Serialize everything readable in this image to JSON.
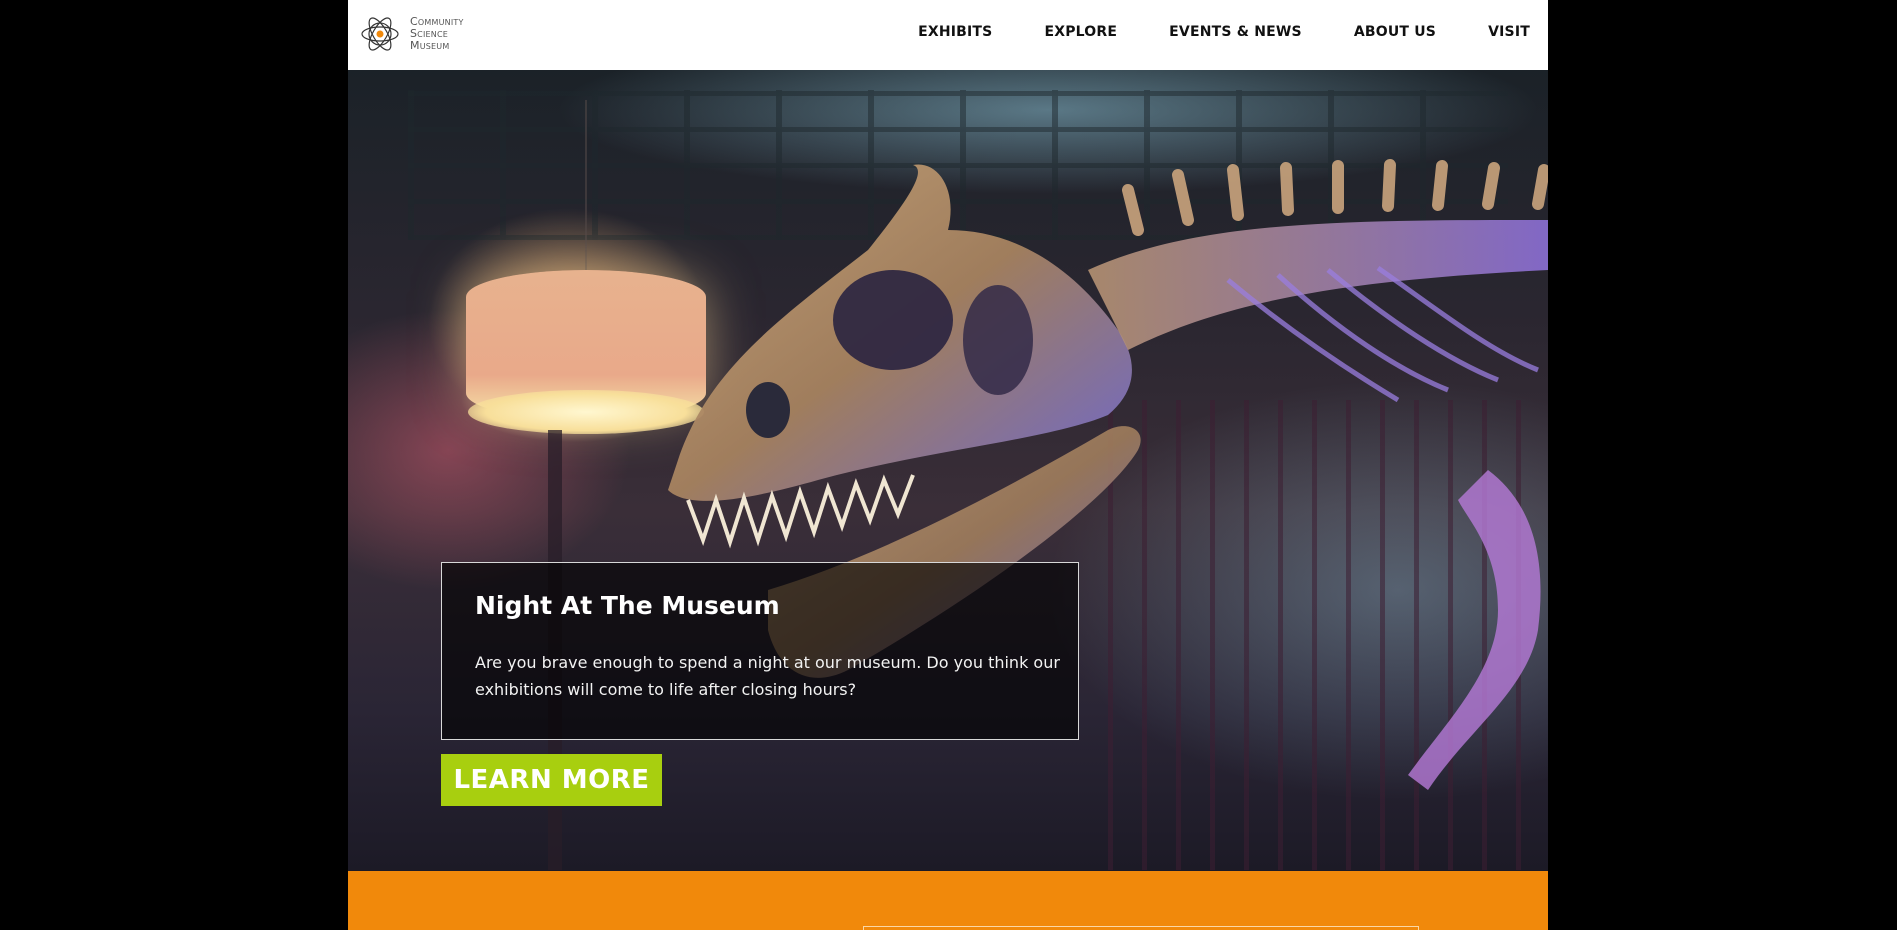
{
  "brand": {
    "logo_icon": "atom-icon",
    "name_lines": [
      "Community",
      "Science",
      "Museum"
    ]
  },
  "nav": {
    "items": [
      "EXHIBITS",
      "EXPLORE",
      "EVENTS & NEWS",
      "ABOUT US",
      "VISIT"
    ]
  },
  "hero": {
    "title": "Night At The Museum",
    "description": "Are you brave enough to spend a night at our museum. Do you think our exhibitions will come to life after closing hours?",
    "cta_label": "LEARN MORE"
  },
  "colors": {
    "accent_green": "#a8cf0f",
    "accent_orange": "#f1890b",
    "background": "#000000"
  }
}
